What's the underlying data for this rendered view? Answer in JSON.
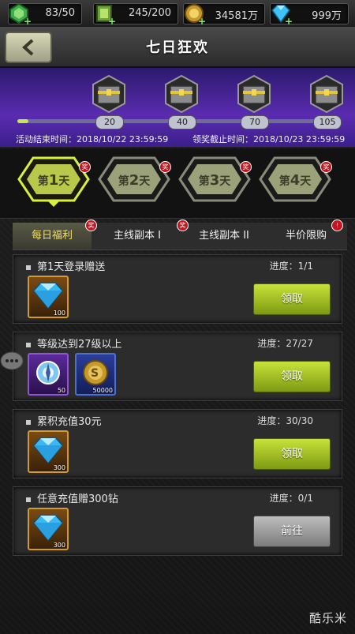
{
  "resources": [
    {
      "icon": "green-gem-icon",
      "value": "83/50"
    },
    {
      "icon": "green-crystal-icon",
      "value": "245/200"
    },
    {
      "icon": "gold-coin-icon",
      "value": "34581万"
    },
    {
      "icon": "diamond-icon",
      "value": "999万"
    }
  ],
  "header": {
    "title": "七日狂欢"
  },
  "progress": {
    "fraction": 0.0,
    "milestones": [
      "20",
      "40",
      "70",
      "105"
    ],
    "activity_end": "活动结束时间：2018/10/22 23:59:59",
    "claim_deadline": "领奖截止时间：2018/10/23 23:59:59"
  },
  "days": [
    {
      "prefix": "第",
      "num": "1",
      "suffix": "天",
      "active": true
    },
    {
      "prefix": "第",
      "num": "2",
      "suffix": "天",
      "active": false
    },
    {
      "prefix": "第",
      "num": "3",
      "suffix": "天",
      "active": false
    },
    {
      "prefix": "第",
      "num": "4",
      "suffix": "天",
      "active": false
    }
  ],
  "badge_text": "奖",
  "subtabs": [
    "每日福利",
    "主线副本 I",
    "主线副本 II",
    "半价限购"
  ],
  "tasks": [
    {
      "title": "第1天登录赠送",
      "progress": "进度：1/1",
      "items": [
        {
          "type": "diamond",
          "amount": "100"
        }
      ],
      "button": "领取",
      "button_style": "green"
    },
    {
      "title": "等级达到27级以上",
      "progress": "进度：27/27",
      "items": [
        {
          "type": "compass",
          "amount": "50"
        },
        {
          "type": "coin",
          "amount": "50000"
        }
      ],
      "button": "领取",
      "button_style": "green"
    },
    {
      "title": "累积充值30元",
      "progress": "进度：30/30",
      "items": [
        {
          "type": "diamond",
          "amount": "300"
        }
      ],
      "button": "领取",
      "button_style": "green"
    },
    {
      "title": "任意充值赠300钻",
      "progress": "进度：0/1",
      "items": [
        {
          "type": "diamond",
          "amount": "300"
        }
      ],
      "button": "前往",
      "button_style": "gray"
    }
  ],
  "watermark": "酷乐米",
  "colors": {
    "accent": "#c7e23a",
    "purple": "#5a2bb0"
  }
}
